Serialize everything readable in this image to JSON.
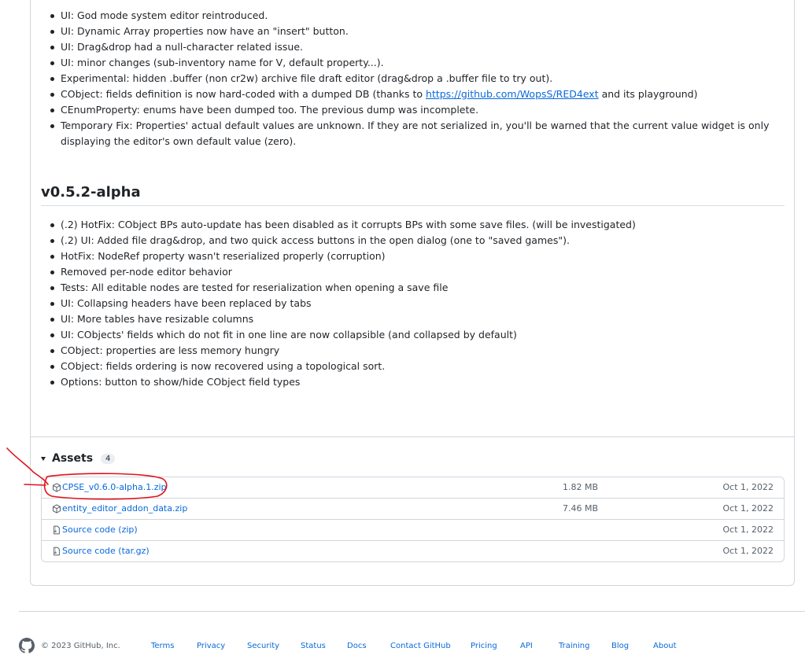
{
  "notes_top": [
    {
      "text": "UI: God mode system editor reintroduced."
    },
    {
      "text": "UI: Dynamic Array properties now have an \"insert\" button."
    },
    {
      "text": "UI: Drag&drop had a null-character related issue."
    },
    {
      "text": "UI: minor changes (sub-inventory name for V, default property...)."
    },
    {
      "text": "Experimental: hidden .buffer (non cr2w) archive file draft editor (drag&drop a .buffer file to try out)."
    },
    {
      "text_before": "CObject: fields definition is now hard-coded with a dumped DB (thanks to ",
      "link": "https://github.com/WopsS/RED4ext",
      "text_after": " and its playground)"
    },
    {
      "text": "CEnumProperty: enums have been dumped too. The previous dump was incomplete."
    },
    {
      "text": "Temporary Fix: Properties' actual default values are unknown. If they are not serialized in, you'll be warned that the current value widget is only displaying the editor's own default value (zero)."
    }
  ],
  "version_heading": "v0.5.2-alpha",
  "notes_v052": [
    "(.2) HotFix: CObject BPs auto-update has been disabled as it corrupts BPs with some save files. (will be investigated)",
    "(.2) UI: Added file drag&drop, and two quick access buttons in the open dialog (one to \"saved games\").",
    "HotFix: NodeRef property wasn't reserialized properly (corruption)",
    "Removed per-node editor behavior",
    "Tests: All editable nodes are tested for reserialization when opening a save file",
    "UI: Collapsing headers have been replaced by tabs",
    "UI: More tables have resizable columns",
    "UI: CObjects' fields which do not fit in one line are now collapsible (and collapsed by default)",
    "CObject: properties are less memory hungry",
    "CObject: fields ordering is now recovered using a topological sort.",
    "Options: button to show/hide CObject field types"
  ],
  "assets": {
    "title": "Assets",
    "count": "4",
    "rows": [
      {
        "icon": "package-icon",
        "name": "CPSE_v0.6.0-alpha.1.zip",
        "size": "1.82 MB",
        "date": "Oct 1, 2022"
      },
      {
        "icon": "package-icon",
        "name": "entity_editor_addon_data.zip",
        "size": "7.46 MB",
        "date": "Oct 1, 2022"
      },
      {
        "icon": "file-zip-icon",
        "name": "Source code (zip)",
        "size": "",
        "date": "Oct 1, 2022"
      },
      {
        "icon": "file-zip-icon",
        "name": "Source code (tar.gz)",
        "size": "",
        "date": "Oct 1, 2022"
      }
    ]
  },
  "annotation_color": "#e0141e",
  "footer": {
    "copyright": "© 2023 GitHub, Inc.",
    "links": [
      "Terms",
      "Privacy",
      "Security",
      "Status",
      "Docs",
      "Contact GitHub",
      "Pricing",
      "API",
      "Training",
      "Blog",
      "About"
    ]
  }
}
